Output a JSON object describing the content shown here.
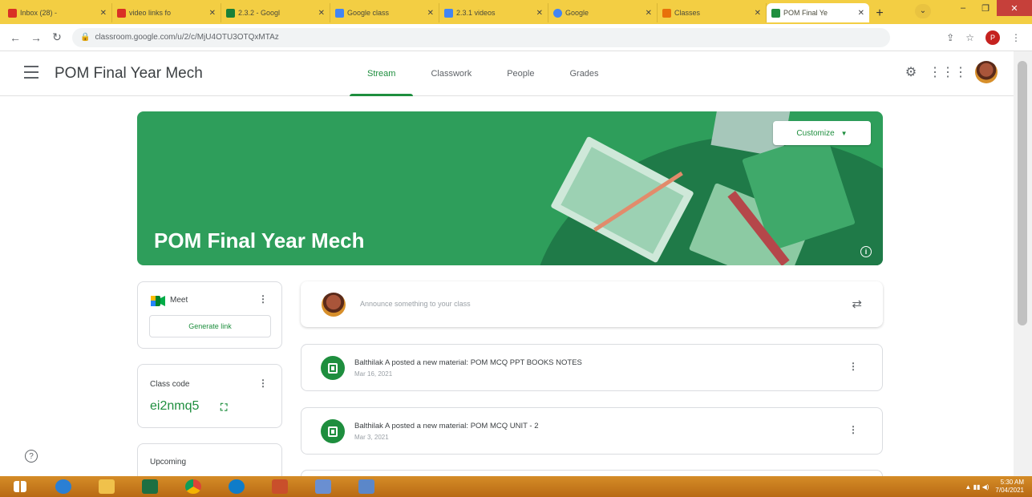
{
  "browser": {
    "tabs": [
      {
        "label": "Inbox (28) - ",
        "favicon_color": "#d93025",
        "active": false
      },
      {
        "label": "video links fo",
        "favicon_color": "#d93025",
        "active": false
      },
      {
        "label": "2.3.2 - Googl",
        "favicon_color": "#188038",
        "active": false
      },
      {
        "label": "Google class",
        "favicon_color": "#4285f4",
        "active": false
      },
      {
        "label": "2.3.1 videos",
        "favicon_color": "#4285f4",
        "active": false
      },
      {
        "label": "Google",
        "favicon_color": "#4285f4",
        "active": false
      },
      {
        "label": "Classes",
        "favicon_color": "#e8710a",
        "active": false
      },
      {
        "label": "POM Final Ye",
        "favicon_color": "#1e8e3e",
        "active": true
      }
    ],
    "url": "classroom.google.com/u/2/c/MjU4OTU3OTQxMTAz",
    "profile_initial": "P"
  },
  "classroom": {
    "title": "POM Final Year Mech",
    "tabs": [
      "Stream",
      "Classwork",
      "People",
      "Grades"
    ],
    "active_tab": "Stream"
  },
  "banner": {
    "title": "POM Final Year Mech",
    "customize_label": "Customize",
    "color": "#2e9e5b"
  },
  "meet": {
    "label": "Meet",
    "generate_link_label": "Generate link"
  },
  "class_code": {
    "label": "Class code",
    "value": "ei2nmq5"
  },
  "upcoming": {
    "label": "Upcoming"
  },
  "announce": {
    "placeholder": "Announce something to your class"
  },
  "posts": [
    {
      "title": "Balthilak A posted a new material: POM MCQ PPT BOOKS NOTES",
      "date": "Mar 16, 2021"
    },
    {
      "title": "Balthilak A posted a new material: POM MCQ UNIT - 2",
      "date": "Mar 3, 2021"
    }
  ],
  "taskbar": {
    "time": "5:30 AM",
    "date": "7/04/2021"
  },
  "accent_color": "#1e8e3e"
}
